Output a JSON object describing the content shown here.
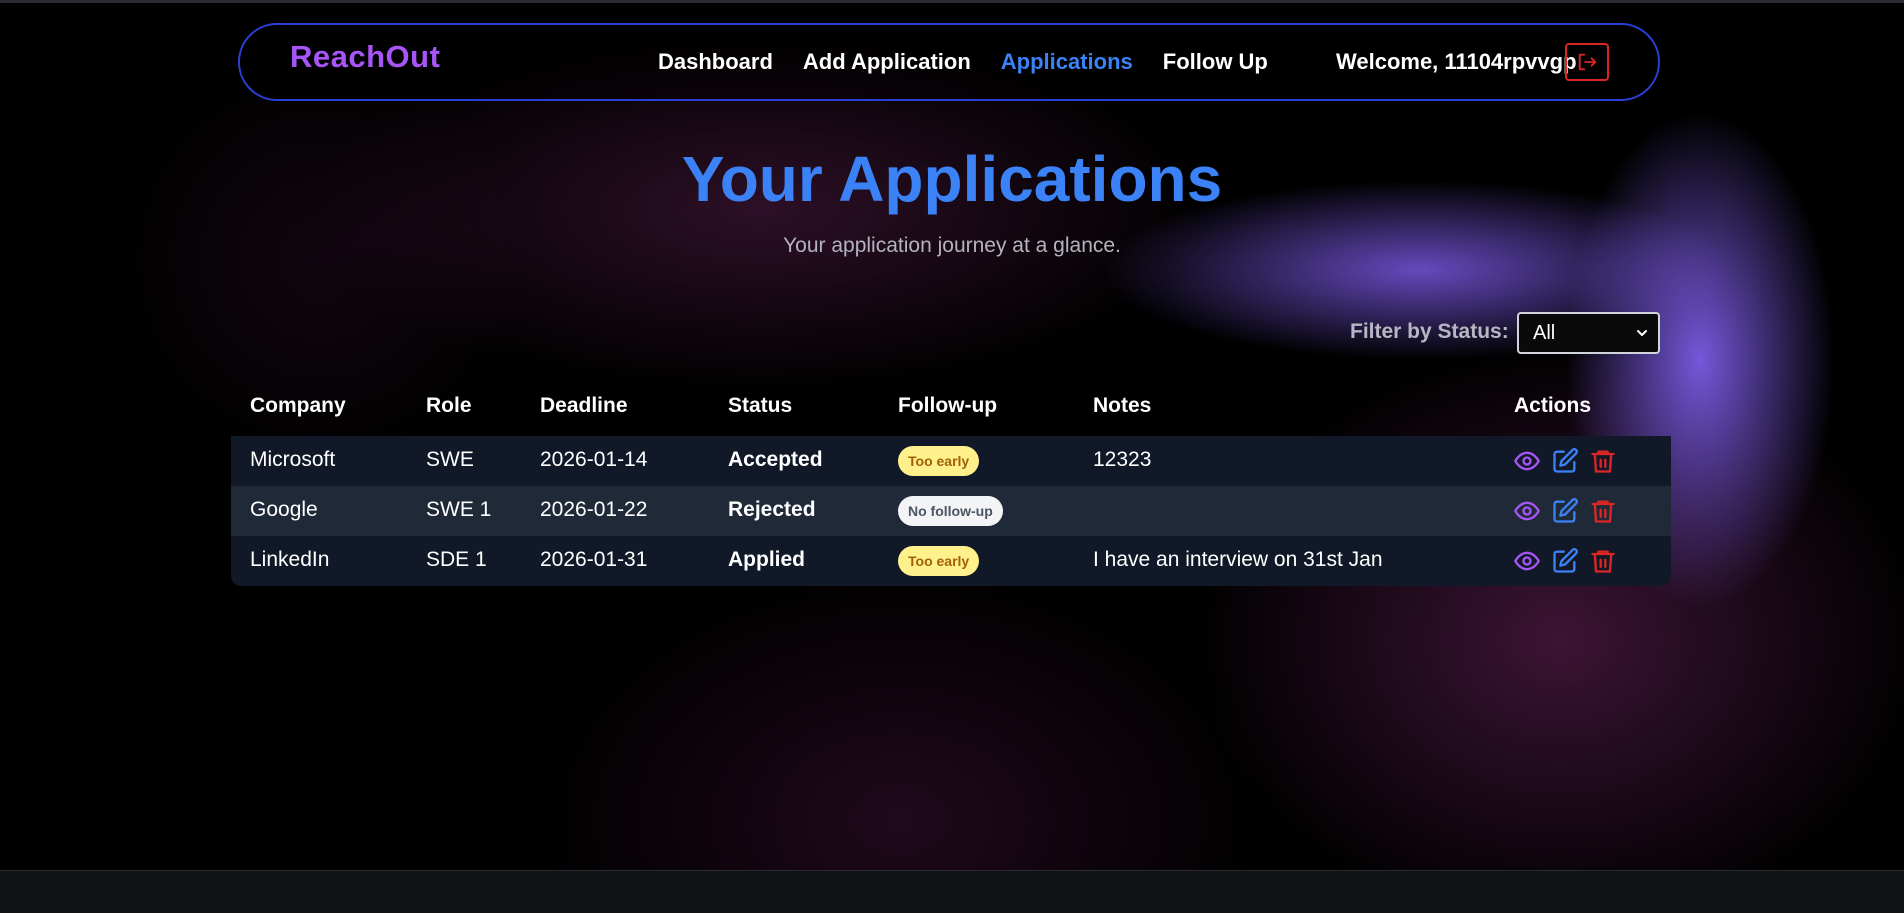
{
  "colors": {
    "accent_blue": "#3b82f6",
    "brand_purple": "#a855f7",
    "danger_red": "#dc2626",
    "badge_early_bg": "#fef08a",
    "badge_none_bg": "#f3f4f6"
  },
  "navbar": {
    "brand": "ReachOut",
    "links": [
      {
        "label": "Dashboard",
        "active": false
      },
      {
        "label": "Add Application",
        "active": false
      },
      {
        "label": "Applications",
        "active": true
      },
      {
        "label": "Follow Up",
        "active": false
      }
    ],
    "welcome": "Welcome, 11104rpvvgp",
    "logout_icon": "logout-icon"
  },
  "header": {
    "title": "Your Applications",
    "subtitle": "Your application journey at a glance."
  },
  "filter": {
    "label": "Filter by Status:",
    "selected": "All"
  },
  "table": {
    "columns": [
      "Company",
      "Role",
      "Deadline",
      "Status",
      "Follow-up",
      "Notes",
      "Actions"
    ],
    "rows": [
      {
        "company": "Microsoft",
        "role": "SWE",
        "deadline": "2026-01-14",
        "status": "Accepted",
        "followup": "Too early",
        "notes": "12323"
      },
      {
        "company": "Google",
        "role": "SWE 1",
        "deadline": "2026-01-22",
        "status": "Rejected",
        "followup": "No follow-up",
        "notes": ""
      },
      {
        "company": "LinkedIn",
        "role": "SDE 1",
        "deadline": "2026-01-31",
        "status": "Applied",
        "followup": "Too early",
        "notes": "I have an interview on 31st Jan"
      }
    ],
    "action_icons": [
      "eye-icon",
      "edit-icon",
      "trash-icon"
    ]
  }
}
